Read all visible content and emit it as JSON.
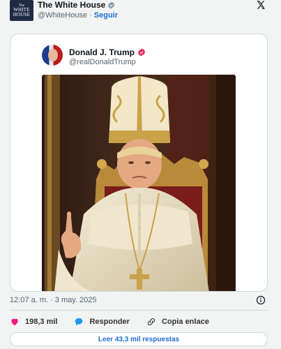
{
  "header": {
    "avatar_lines": [
      "The",
      "WHITE",
      "HOUSE"
    ],
    "display_name": "The White House",
    "handle": "@WhiteHouse",
    "separator": "·",
    "follow_label": "Seguir"
  },
  "quoted": {
    "display_name": "Donald J. Trump",
    "handle": "@realDonaldTrump",
    "badge_color": "#e0245e"
  },
  "meta": {
    "timestamp": "12:07 a. m. · 3 may. 2025"
  },
  "actions": {
    "likes": "198,3 mil",
    "reply_label": "Responder",
    "copy_link_label": "Copia enlace"
  },
  "replies_button": "Leer 43,3 mil respuestas",
  "colors": {
    "link": "#1d6fd8",
    "heart": "#f91880",
    "reply_bubble": "#1d9bf0",
    "verified_gray": "#829aab"
  }
}
